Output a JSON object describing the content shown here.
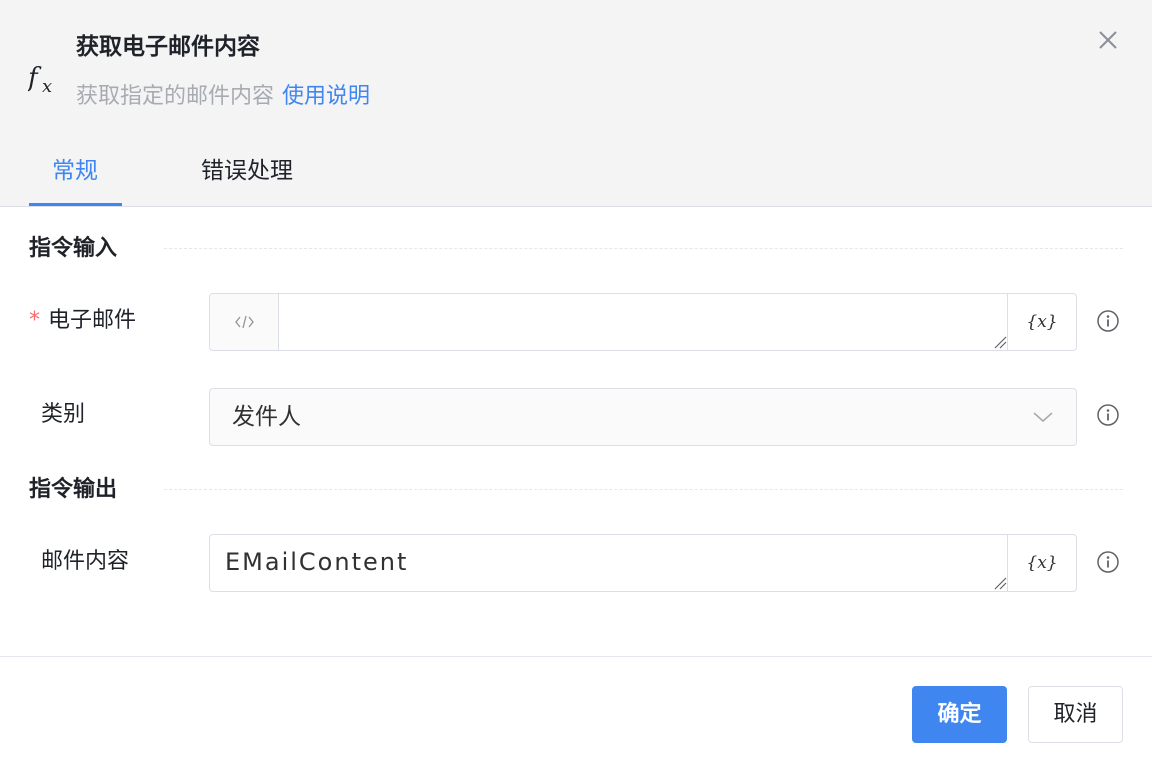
{
  "dialog": {
    "title": "获取电子邮件内容",
    "description": "获取指定的邮件内容",
    "help_link": "使用说明"
  },
  "tabs": [
    {
      "label": "常规",
      "active": true
    },
    {
      "label": "错误处理",
      "active": false
    }
  ],
  "input_section": {
    "title": "指令输入",
    "email": {
      "label": "电子邮件",
      "required_mark": "*",
      "value": "",
      "var_button": "{x}"
    },
    "category": {
      "label": "类别",
      "selected": "发件人"
    }
  },
  "output_section": {
    "title": "指令输出",
    "content": {
      "label": "邮件内容",
      "value": "EMailContent",
      "var_button": "{x}"
    }
  },
  "footer": {
    "ok_label": "确定",
    "cancel_label": "取消"
  },
  "colors": {
    "accent": "#3f86f1",
    "required": "#f56c6c",
    "header_bg": "#f4f4f5"
  },
  "icons": [
    "fx-icon",
    "close-icon",
    "code-icon",
    "info-icon",
    "chevron-down-icon"
  ]
}
